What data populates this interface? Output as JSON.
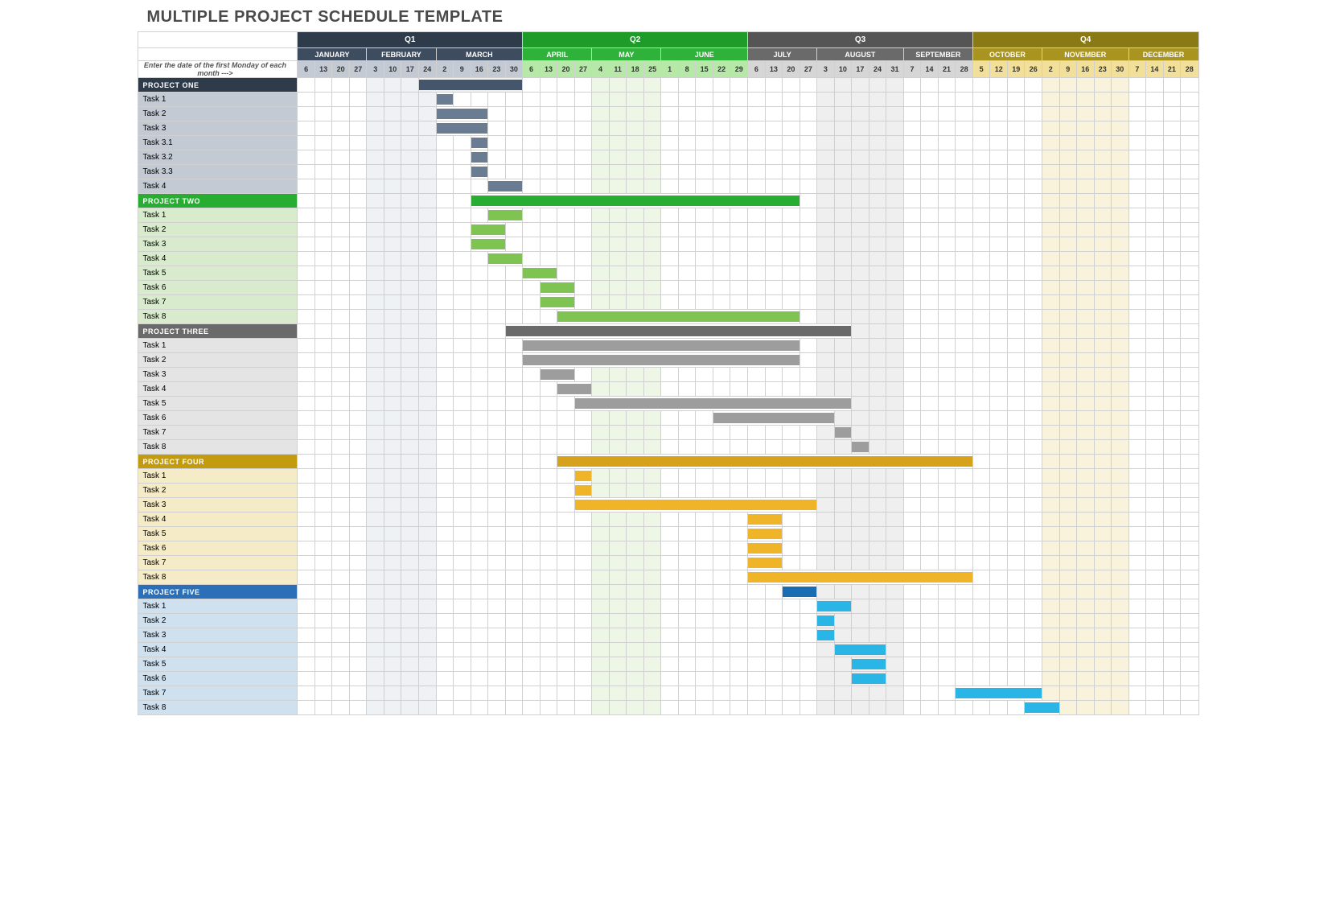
{
  "title": "MULTIPLE PROJECT SCHEDULE TEMPLATE",
  "header_note": "Enter the date of the first Monday of each month --->",
  "quarters": [
    {
      "label": "Q1",
      "qclass": "q1",
      "mclass": "m-q1",
      "wclass": "w-q1",
      "tint": "tint-q1",
      "months": [
        {
          "label": "JANUARY",
          "weeks": [
            6,
            13,
            20,
            27
          ]
        },
        {
          "label": "FEBRUARY",
          "weeks": [
            3,
            10,
            17,
            24
          ]
        },
        {
          "label": "MARCH",
          "weeks": [
            2,
            9,
            16,
            23,
            30
          ]
        }
      ]
    },
    {
      "label": "Q2",
      "qclass": "q2",
      "mclass": "m-q2",
      "wclass": "w-q2",
      "tint": "tint-q2",
      "months": [
        {
          "label": "APRIL",
          "weeks": [
            6,
            13,
            20,
            27
          ]
        },
        {
          "label": "MAY",
          "weeks": [
            4,
            11,
            18,
            25
          ]
        },
        {
          "label": "JUNE",
          "weeks": [
            1,
            8,
            15,
            22,
            29
          ]
        }
      ]
    },
    {
      "label": "Q3",
      "qclass": "q3",
      "mclass": "m-q3",
      "wclass": "w-q3",
      "tint": "tint-q3",
      "months": [
        {
          "label": "JULY",
          "weeks": [
            6,
            13,
            20,
            27
          ]
        },
        {
          "label": "AUGUST",
          "weeks": [
            3,
            10,
            17,
            24,
            31
          ]
        },
        {
          "label": "SEPTEMBER",
          "weeks": [
            7,
            14,
            21,
            28
          ]
        }
      ]
    },
    {
      "label": "Q4",
      "qclass": "q4",
      "mclass": "m-q4",
      "wclass": "w-q4",
      "tint": "tint-q4",
      "months": [
        {
          "label": "OCTOBER",
          "weeks": [
            5,
            12,
            19,
            26
          ]
        },
        {
          "label": "NOVEMBER",
          "weeks": [
            2,
            9,
            16,
            23,
            30
          ]
        },
        {
          "label": "DECEMBER",
          "weeks": [
            7,
            14,
            21,
            28
          ]
        }
      ]
    }
  ],
  "tinted_month_indices": [
    1,
    4,
    7,
    10
  ],
  "chart_data": {
    "type": "gantt",
    "unit": "week",
    "total_weeks": 52,
    "projects": [
      {
        "name": "PROJECT ONE",
        "label_class": "lbl-p1",
        "header_class": "ph-p1",
        "bar_header": "bar-p1-h",
        "bar_class": "bar-p1",
        "header_bar": {
          "start": 8,
          "span": 6
        },
        "tasks": [
          {
            "name": "Task 1",
            "start": 9,
            "span": 1
          },
          {
            "name": "Task 2",
            "start": 9,
            "span": 3
          },
          {
            "name": "Task 3",
            "start": 9,
            "span": 3
          },
          {
            "name": "Task 3.1",
            "start": 11,
            "span": 1
          },
          {
            "name": "Task 3.2",
            "start": 11,
            "span": 1
          },
          {
            "name": "Task 3.3",
            "start": 11,
            "span": 1
          },
          {
            "name": "Task 4",
            "start": 12,
            "span": 2
          }
        ]
      },
      {
        "name": "PROJECT TWO",
        "label_class": "lbl-p2",
        "header_class": "ph-p2",
        "bar_header": "bar-p2-h",
        "bar_class": "bar-p2",
        "header_bar": {
          "start": 11,
          "span": 19
        },
        "tasks": [
          {
            "name": "Task 1",
            "start": 12,
            "span": 2
          },
          {
            "name": "Task 2",
            "start": 11,
            "span": 2
          },
          {
            "name": "Task 3",
            "start": 11,
            "span": 2
          },
          {
            "name": "Task 4",
            "start": 12,
            "span": 2
          },
          {
            "name": "Task 5",
            "start": 14,
            "span": 2
          },
          {
            "name": "Task 6",
            "start": 15,
            "span": 2
          },
          {
            "name": "Task 7",
            "start": 15,
            "span": 2
          },
          {
            "name": "Task 8",
            "start": 16,
            "span": 14
          }
        ]
      },
      {
        "name": "PROJECT THREE",
        "label_class": "lbl-p3",
        "header_class": "ph-p3",
        "bar_header": "bar-p3-h",
        "bar_class": "bar-p3",
        "header_bar": {
          "start": 13,
          "span": 20
        },
        "tasks": [
          {
            "name": "Task 1",
            "start": 14,
            "span": 16
          },
          {
            "name": "Task 2",
            "start": 14,
            "span": 16
          },
          {
            "name": "Task 3",
            "start": 15,
            "span": 2
          },
          {
            "name": "Task 4",
            "start": 16,
            "span": 2
          },
          {
            "name": "Task 5",
            "start": 17,
            "span": 16
          },
          {
            "name": "Task 6",
            "start": 25,
            "span": 7
          },
          {
            "name": "Task 7",
            "start": 32,
            "span": 1
          },
          {
            "name": "Task 8",
            "start": 33,
            "span": 1
          }
        ]
      },
      {
        "name": "PROJECT FOUR",
        "label_class": "lbl-p4",
        "header_class": "ph-p4",
        "bar_header": "bar-p4-h",
        "bar_class": "bar-p4",
        "header_bar": {
          "start": 16,
          "span": 24
        },
        "tasks": [
          {
            "name": "Task 1",
            "start": 17,
            "span": 1
          },
          {
            "name": "Task 2",
            "start": 17,
            "span": 1
          },
          {
            "name": "Task 3",
            "start": 17,
            "span": 14
          },
          {
            "name": "Task 4",
            "start": 27,
            "span": 2
          },
          {
            "name": "Task 5",
            "start": 27,
            "span": 2
          },
          {
            "name": "Task 6",
            "start": 27,
            "span": 2
          },
          {
            "name": "Task 7",
            "start": 27,
            "span": 2
          },
          {
            "name": "Task 8",
            "start": 27,
            "span": 13
          }
        ]
      },
      {
        "name": "PROJECT FIVE",
        "label_class": "lbl-p5",
        "header_class": "ph-p5",
        "bar_header": "bar-p5-h",
        "bar_class": "bar-p5",
        "header_bar": {
          "start": 29,
          "span": 2
        },
        "tasks": [
          {
            "name": "Task 1",
            "start": 31,
            "span": 2
          },
          {
            "name": "Task 2",
            "start": 31,
            "span": 1
          },
          {
            "name": "Task 3",
            "start": 31,
            "span": 1
          },
          {
            "name": "Task 4",
            "start": 32,
            "span": 3
          },
          {
            "name": "Task 5",
            "start": 33,
            "span": 2
          },
          {
            "name": "Task 6",
            "start": 33,
            "span": 2
          },
          {
            "name": "Task 7",
            "start": 39,
            "span": 5
          },
          {
            "name": "Task 8",
            "start": 43,
            "span": 2
          }
        ]
      }
    ]
  }
}
